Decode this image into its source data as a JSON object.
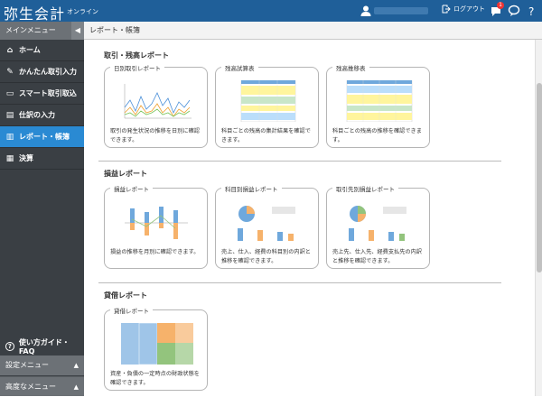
{
  "app": {
    "logo": "弥生会計",
    "logo_sub": "オンライン",
    "logout": "ログアウト",
    "notification_count": "1"
  },
  "sidebar": {
    "header": "メインメニュー",
    "items": [
      {
        "label": "ホーム",
        "icon": "home-icon"
      },
      {
        "label": "かんたん取引入力",
        "icon": "pencil-icon"
      },
      {
        "label": "スマート取引取込",
        "icon": "import-icon"
      },
      {
        "label": "仕訳の入力",
        "icon": "journal-icon"
      },
      {
        "label": "レポート・帳簿",
        "icon": "chart-icon",
        "active": true
      },
      {
        "label": "決算",
        "icon": "calculator-icon"
      }
    ],
    "faq": "使い方ガイド・FAQ",
    "settings_menu": "設定メニュー",
    "advanced_menu": "高度なメニュー"
  },
  "main": {
    "breadcrumb": "レポート・帳簿",
    "sections": [
      {
        "title": "取引・残高レポート",
        "cards": [
          {
            "title": "日別取引レポート",
            "desc": "取引の発生状況の推移を日別に確認できます。"
          },
          {
            "title": "残高試算表",
            "desc": "科目ごとの残高の集計結果を確認できます。"
          },
          {
            "title": "残高推移表",
            "desc": "科目ごとの残高の推移を確認できます。"
          }
        ]
      },
      {
        "title": "損益レポート",
        "cards": [
          {
            "title": "損益レポート",
            "desc": "損益の推移を月別に確認できます。"
          },
          {
            "title": "科目別損益レポート",
            "desc": "売上、仕入、経費の科目別の内訳と推移を確認できます。"
          },
          {
            "title": "取引先別損益レポート",
            "desc": "売上先、仕入先、経費支払先の内訳と推移を確認できます。"
          }
        ]
      },
      {
        "title": "貸借レポート",
        "cards": [
          {
            "title": "貸借レポート",
            "desc": "資産・負債の一定時点の財政状態を確認できます。"
          }
        ]
      }
    ]
  },
  "colors": {
    "topbar": "#1f5f99",
    "sidebar": "#3a3f44",
    "active": "#2a8ad3"
  }
}
